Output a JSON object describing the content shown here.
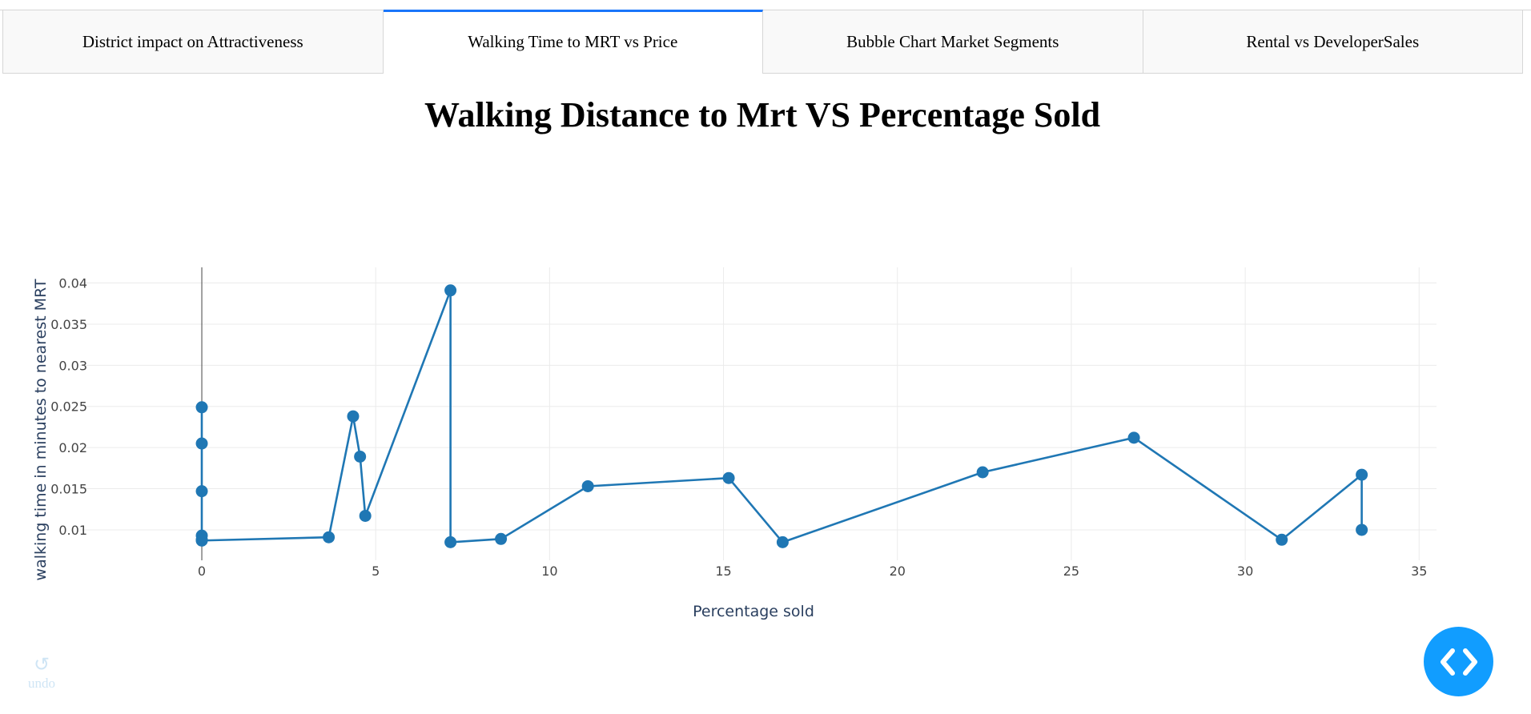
{
  "tabs": [
    {
      "label": "District impact on Attractiveness",
      "active": false
    },
    {
      "label": "Walking Time to MRT vs Price",
      "active": true
    },
    {
      "label": "Bubble Chart Market Segments",
      "active": false
    },
    {
      "label": "Rental vs DeveloperSales",
      "active": false
    }
  ],
  "page_title": "Walking Distance to Mrt VS Percentage Sold",
  "undo": {
    "icon": "undo-icon",
    "label": "undo"
  },
  "code_toggle": {
    "icon": "code-brackets-icon",
    "color": "#119DFF"
  },
  "chart_data": {
    "type": "line",
    "mode": "lines+markers",
    "title": "",
    "xlabel": "Percentage sold",
    "ylabel": "walking time in minutes to nearest MRT",
    "xlim": [
      -3.5,
      35.5
    ],
    "ylim": [
      0.0063,
      0.0419
    ],
    "x_ticks": [
      "0",
      "5",
      "10",
      "15",
      "20",
      "25",
      "30",
      "35"
    ],
    "x_tick_values": [
      0,
      5,
      10,
      15,
      20,
      25,
      30,
      35
    ],
    "y_ticks": [
      "0.01",
      "0.015",
      "0.02",
      "0.025",
      "0.03",
      "0.035",
      "0.04"
    ],
    "y_tick_values": [
      0.01,
      0.015,
      0.02,
      0.025,
      0.03,
      0.035,
      0.04
    ],
    "grid": true,
    "zeroline_x": true,
    "line_color": "#1f77b4",
    "series": [
      {
        "x": [
          0,
          0,
          0,
          0,
          0,
          0,
          3.65,
          4.35,
          4.55,
          4.7,
          7.15,
          7.15,
          8.6,
          11.1,
          15.15,
          16.7,
          22.45,
          26.8,
          31.05,
          33.35,
          33.35
        ],
        "y": [
          0.0249,
          0.0205,
          0.0147,
          0.0093,
          0.0088,
          0.0087,
          0.0091,
          0.0238,
          0.0189,
          0.0117,
          0.0391,
          0.0085,
          0.0089,
          0.0153,
          0.0163,
          0.0085,
          0.017,
          0.0212,
          0.0088,
          0.0167,
          0.01
        ]
      }
    ]
  }
}
